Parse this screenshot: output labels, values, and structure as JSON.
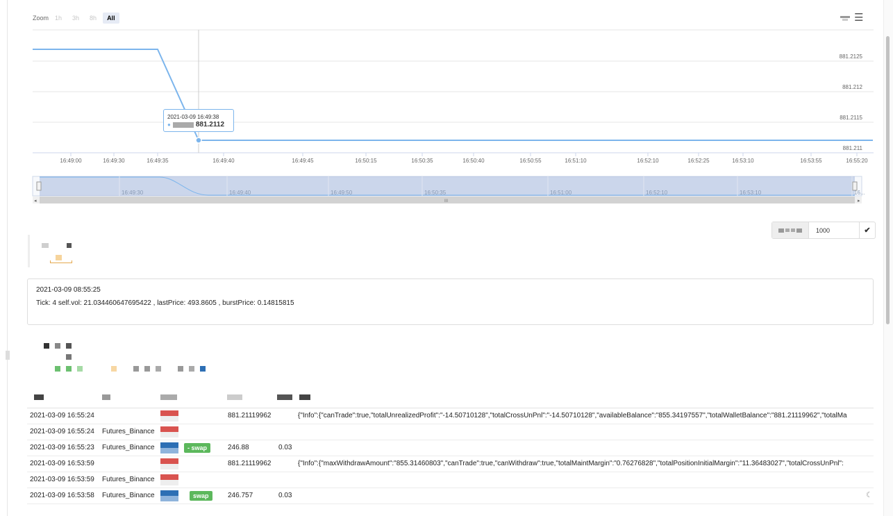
{
  "zoom": {
    "label": "Zoom",
    "options": [
      "1h",
      "3h",
      "8h",
      "All"
    ],
    "active": "All"
  },
  "chart_data": {
    "type": "line",
    "x": [
      "16:49:00",
      "16:49:30",
      "16:49:35",
      "16:49:38",
      "16:49:40",
      "16:49:45",
      "16:50:15",
      "16:50:35",
      "16:50:40",
      "16:50:55",
      "16:51:10",
      "16:52:10",
      "16:52:25",
      "16:53:10",
      "16:53:55",
      "16:55:20"
    ],
    "series": [
      {
        "values": [
          881.2127,
          881.2127,
          881.2127,
          881.2112,
          881.2112,
          881.2112,
          881.2112,
          881.2112,
          881.2112,
          881.2112,
          881.2112,
          881.2112,
          881.2112,
          881.2112,
          881.2112,
          881.2112
        ]
      }
    ],
    "xticks": [
      "16:49:00",
      "16:49:30",
      "16:49:35",
      "16:49:40",
      "16:49:45",
      "16:50:15",
      "16:50:35",
      "16:50:40",
      "16:50:55",
      "16:51:10",
      "16:52:10",
      "16:52:25",
      "16:53:10",
      "16:53:55",
      "16:55:20"
    ],
    "yticks": [
      "881.2125",
      "881.212",
      "881.2115",
      "881.211"
    ],
    "ylim": [
      881.211,
      881.2128
    ],
    "navigator_labels": [
      "16:49:30",
      "16:49:40",
      "16:49:50",
      "16:50:35",
      "16:51:00",
      "16:52:10",
      "16:53:10",
      "16..."
    ],
    "navigator_scroll_label": "III",
    "line_color": "#7cb5ec",
    "grid": true
  },
  "tooltip": {
    "time": "2021-03-09 16:49:38",
    "value": "881.2112"
  },
  "limit": {
    "value": "1000",
    "confirm_icon": "check-icon"
  },
  "log": {
    "time": "2021-03-09 08:55:25",
    "message": "Tick: 4 self.vol: 21.034460647695422 , lastPrice: 493.8605 , burstPrice: 0.14815815"
  },
  "table": {
    "rows": [
      {
        "time": "2021-03-09 16:55:24",
        "exchange": "",
        "price": "881.21119962",
        "amount": "",
        "extra": "{\"Info\":{\"canTrade\":true,\"totalUnrealizedProfit\":\"-14.50710128\",\"totalCrossUnPnl\":\"-14.50710128\",\"availableBalance\":\"855.34197557\",\"totalWalletBalance\":\"881.21119962\",\"totalMa",
        "badge": ""
      },
      {
        "time": "2021-03-09 16:55:24",
        "exchange": "Futures_Binance",
        "price": "",
        "amount": "",
        "extra": "",
        "badge": ""
      },
      {
        "time": "2021-03-09 16:55:23",
        "exchange": "Futures_Binance",
        "price": "246.88",
        "amount": "0.03",
        "extra": "",
        "badge": "- swap"
      },
      {
        "time": "2021-03-09 16:53:59",
        "exchange": "",
        "price": "881.21119962",
        "amount": "",
        "extra": "{\"Info\":{\"maxWithdrawAmount\":\"855.31460803\",\"canTrade\":true,\"canWithdraw\":true,\"totalMaintMargin\":\"0.76276828\",\"totalPositionInitialMargin\":\"11.36483027\",\"totalCrossUnPnl\":",
        "badge": ""
      },
      {
        "time": "2021-03-09 16:53:59",
        "exchange": "Futures_Binance",
        "price": "",
        "amount": "",
        "extra": "",
        "badge": ""
      },
      {
        "time": "2021-03-09 16:53:58",
        "exchange": "Futures_Binance",
        "price": "246.757",
        "amount": "0.03",
        "extra": "",
        "badge": "swap"
      }
    ]
  },
  "theme_toggle_icon": "moon-icon"
}
